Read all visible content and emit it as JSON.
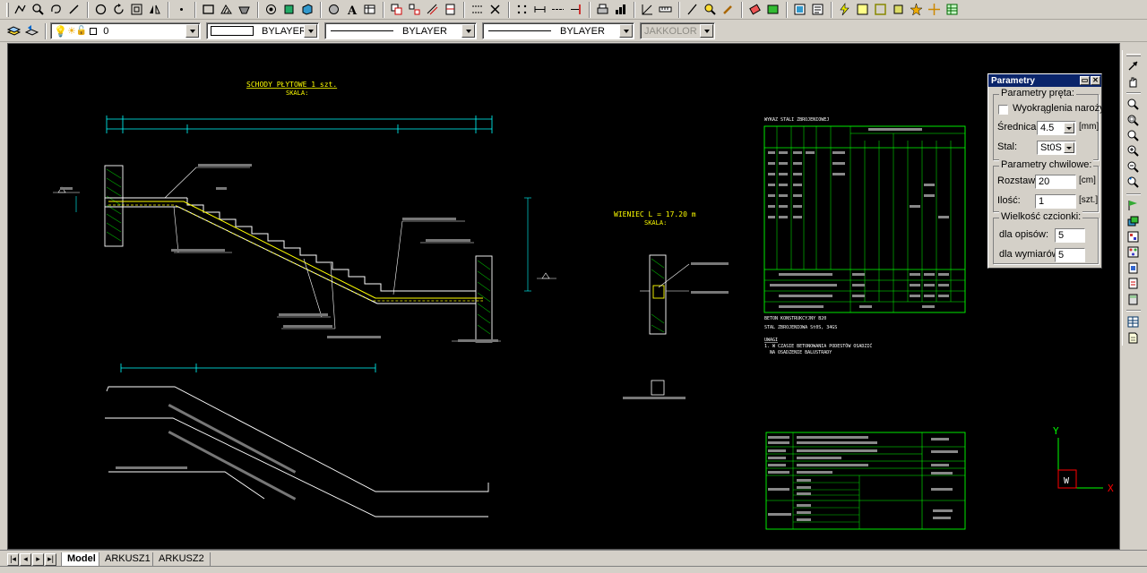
{
  "properties_bar": {
    "layer_value": "0",
    "linetype_label": "BYLAYER",
    "lineweight_label": "BYLAYER",
    "plotstyle_label": "BYLAYER",
    "color_label": "JAKKOLOR"
  },
  "params_palette": {
    "title": "Parametry",
    "group_bar_params": "Parametry pręta:",
    "corner_rounding_label": "Wyokrąglenia naroży",
    "diameter_label": "Średnica:",
    "diameter_value": "4.5",
    "diameter_unit": "[mm]",
    "steel_label": "Stal:",
    "steel_value": "St0S",
    "group_temp_params": "Parametry chwilowe:",
    "spacing_label": "Rozstaw:",
    "spacing_value": "20",
    "spacing_unit": "[cm]",
    "count_label": "Ilość:",
    "count_value": "1",
    "count_unit": "[szt.]",
    "group_font_size": "Wielkość czcionki:",
    "desc_label": "dla opisów:",
    "desc_value": "5",
    "dims_label": "dla wymiarów:",
    "dims_value": "5"
  },
  "drawing": {
    "stairs_title": "SCHODY PŁYTOWE 1 szt.",
    "stairs_scale": "SKALA:",
    "ring_beam_title": "WIENIEC L = 17.20 m",
    "ring_beam_scale": "SKALA:",
    "steel_table_title": "WYKAZ STALI ZBROJENIOWEJ",
    "concrete_note": "BETON KONSTRUKCYJNY B20",
    "steel_note": "STAL ZBROJENIOWA St0S, 34GS",
    "remarks_title": "UWAGI",
    "remark_1": "1. W CZASIE BETONOWANIA PODESTÓW OSADZIĆ",
    "remark_2": "NA OSADZENIE BALUSTRADY",
    "ucs_y": "Y",
    "ucs_x": "X",
    "ucs_w": "W"
  },
  "tabs": [
    {
      "label": "Model",
      "active": true
    },
    {
      "label": "ARKUSZ1",
      "active": false
    },
    {
      "label": "ARKUSZ2",
      "active": false
    }
  ],
  "colors": {
    "canvas_bg": "#000000",
    "geometry": "#ffffff",
    "rebar": "#ffff00",
    "dimensions": "#00ffff",
    "table": "#00ff00",
    "ucs_axis": "#ff0000"
  }
}
